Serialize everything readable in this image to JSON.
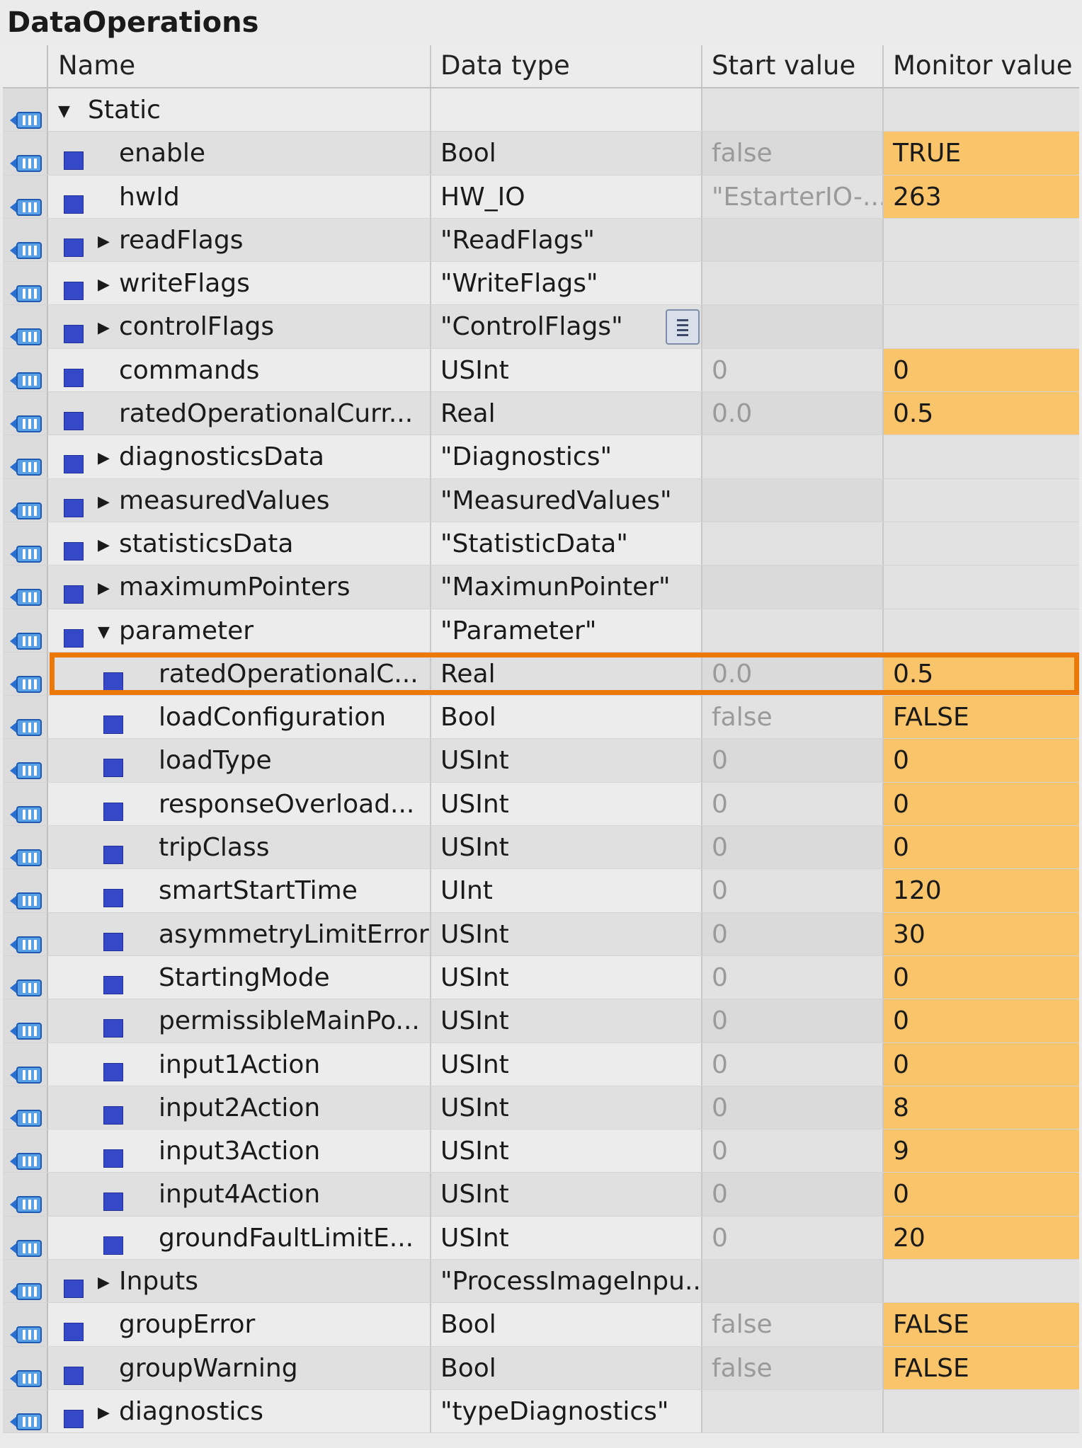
{
  "window_title": "DataOperations",
  "columns": {
    "name": "Name",
    "data_type": "Data type",
    "start_value": "Start value",
    "monitor_value": "Monitor value"
  },
  "colors": {
    "monitor_highlight": "#f9c46a",
    "selection_border": "#ec780a",
    "member_icon": "#3448c8"
  },
  "rows": [
    {
      "name": "Static",
      "type": "",
      "start": "",
      "monitor": "",
      "level": 0,
      "expander": "expanded",
      "member_icon": false,
      "monitored": false
    },
    {
      "name": "enable",
      "type": "Bool",
      "start": "false",
      "monitor": "TRUE",
      "level": 1,
      "expander": "none",
      "member_icon": true,
      "monitored": true
    },
    {
      "name": "hwId",
      "type": "HW_IO",
      "start": "\"EstarterIO-...",
      "monitor": "263",
      "level": 1,
      "expander": "none",
      "member_icon": true,
      "monitored": true
    },
    {
      "name": "readFlags",
      "type": "\"ReadFlags\"",
      "start": "",
      "monitor": "",
      "level": 1,
      "expander": "collapsed",
      "member_icon": true,
      "monitored": false
    },
    {
      "name": "writeFlags",
      "type": "\"WriteFlags\"",
      "start": "",
      "monitor": "",
      "level": 1,
      "expander": "collapsed",
      "member_icon": true,
      "monitored": false
    },
    {
      "name": "controlFlags",
      "type": "\"ControlFlags\"",
      "start": "",
      "monitor": "",
      "level": 1,
      "expander": "collapsed",
      "member_icon": true,
      "monitored": false,
      "menu_button": true
    },
    {
      "name": "commands",
      "type": "USInt",
      "start": "0",
      "monitor": "0",
      "level": 1,
      "expander": "none",
      "member_icon": true,
      "monitored": true
    },
    {
      "name": "ratedOperationalCurr...",
      "type": "Real",
      "start": "0.0",
      "monitor": "0.5",
      "level": 1,
      "expander": "none",
      "member_icon": true,
      "monitored": true
    },
    {
      "name": "diagnosticsData",
      "type": "\"Diagnostics\"",
      "start": "",
      "monitor": "",
      "level": 1,
      "expander": "collapsed",
      "member_icon": true,
      "monitored": false
    },
    {
      "name": "measuredValues",
      "type": "\"MeasuredValues\"",
      "start": "",
      "monitor": "",
      "level": 1,
      "expander": "collapsed",
      "member_icon": true,
      "monitored": false
    },
    {
      "name": "statisticsData",
      "type": "\"StatisticData\"",
      "start": "",
      "monitor": "",
      "level": 1,
      "expander": "collapsed",
      "member_icon": true,
      "monitored": false
    },
    {
      "name": "maximumPointers",
      "type": "\"MaximunPointer\"",
      "start": "",
      "monitor": "",
      "level": 1,
      "expander": "collapsed",
      "member_icon": true,
      "monitored": false
    },
    {
      "name": "parameter",
      "type": "\"Parameter\"",
      "start": "",
      "monitor": "",
      "level": 1,
      "expander": "expanded",
      "member_icon": true,
      "monitored": false
    },
    {
      "name": "ratedOperationalC...",
      "type": "Real",
      "start": "0.0",
      "monitor": "0.5",
      "level": 2,
      "expander": "none",
      "member_icon": true,
      "monitored": true,
      "selected": true
    },
    {
      "name": "loadConfiguration",
      "type": "Bool",
      "start": "false",
      "monitor": "FALSE",
      "level": 2,
      "expander": "none",
      "member_icon": true,
      "monitored": true
    },
    {
      "name": "loadType",
      "type": "USInt",
      "start": "0",
      "monitor": "0",
      "level": 2,
      "expander": "none",
      "member_icon": true,
      "monitored": true
    },
    {
      "name": "responseOverload...",
      "type": "USInt",
      "start": "0",
      "monitor": "0",
      "level": 2,
      "expander": "none",
      "member_icon": true,
      "monitored": true
    },
    {
      "name": "tripClass",
      "type": "USInt",
      "start": "0",
      "monitor": "0",
      "level": 2,
      "expander": "none",
      "member_icon": true,
      "monitored": true
    },
    {
      "name": "smartStartTime",
      "type": "UInt",
      "start": "0",
      "monitor": "120",
      "level": 2,
      "expander": "none",
      "member_icon": true,
      "monitored": true
    },
    {
      "name": "asymmetryLimitError",
      "type": "USInt",
      "start": "0",
      "monitor": "30",
      "level": 2,
      "expander": "none",
      "member_icon": true,
      "monitored": true
    },
    {
      "name": "StartingMode",
      "type": "USInt",
      "start": "0",
      "monitor": "0",
      "level": 2,
      "expander": "none",
      "member_icon": true,
      "monitored": true
    },
    {
      "name": "permissibleMainPo...",
      "type": "USInt",
      "start": "0",
      "monitor": "0",
      "level": 2,
      "expander": "none",
      "member_icon": true,
      "monitored": true
    },
    {
      "name": "input1Action",
      "type": "USInt",
      "start": "0",
      "monitor": "0",
      "level": 2,
      "expander": "none",
      "member_icon": true,
      "monitored": true
    },
    {
      "name": "input2Action",
      "type": "USInt",
      "start": "0",
      "monitor": "8",
      "level": 2,
      "expander": "none",
      "member_icon": true,
      "monitored": true
    },
    {
      "name": "input3Action",
      "type": "USInt",
      "start": "0",
      "monitor": "9",
      "level": 2,
      "expander": "none",
      "member_icon": true,
      "monitored": true
    },
    {
      "name": "input4Action",
      "type": "USInt",
      "start": "0",
      "monitor": "0",
      "level": 2,
      "expander": "none",
      "member_icon": true,
      "monitored": true
    },
    {
      "name": "groundFaultLimitE...",
      "type": "USInt",
      "start": "0",
      "monitor": "20",
      "level": 2,
      "expander": "none",
      "member_icon": true,
      "monitored": true
    },
    {
      "name": "Inputs",
      "type": "\"ProcessImageInpu...",
      "start": "",
      "monitor": "",
      "level": 1,
      "expander": "collapsed",
      "member_icon": true,
      "monitored": false
    },
    {
      "name": "groupError",
      "type": "Bool",
      "start": "false",
      "monitor": "FALSE",
      "level": 1,
      "expander": "none",
      "member_icon": true,
      "monitored": true
    },
    {
      "name": "groupWarning",
      "type": "Bool",
      "start": "false",
      "monitor": "FALSE",
      "level": 1,
      "expander": "none",
      "member_icon": true,
      "monitored": true
    },
    {
      "name": "diagnostics",
      "type": "\"typeDiagnostics\"",
      "start": "",
      "monitor": "",
      "level": 1,
      "expander": "collapsed",
      "member_icon": true,
      "monitored": false
    }
  ]
}
